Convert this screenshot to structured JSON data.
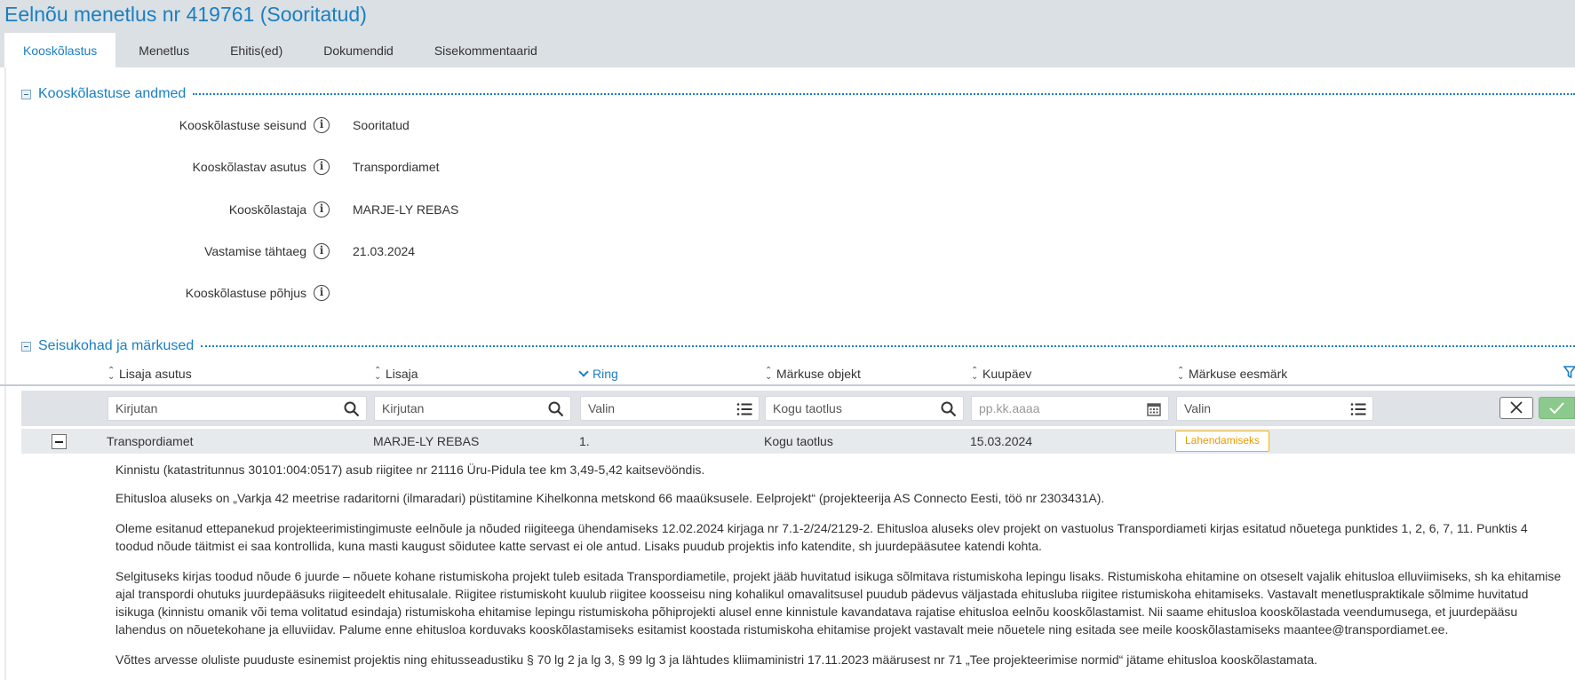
{
  "page": {
    "title": "Eelnõu menetlus nr 419761 (Sooritatud)"
  },
  "tabs": [
    {
      "label": "Kooskõlastus",
      "active": true
    },
    {
      "label": "Menetlus",
      "active": false
    },
    {
      "label": "Ehitis(ed)",
      "active": false
    },
    {
      "label": "Dokumendid",
      "active": false
    },
    {
      "label": "Sisekommentaarid",
      "active": false
    }
  ],
  "section_details": {
    "title": "Kooskõlastuse andmed",
    "fields": [
      {
        "label": "Kooskõlastuse seisund",
        "value": "Sooritatud"
      },
      {
        "label": "Kooskõlastav asutus",
        "value": "Transpordiamet"
      },
      {
        "label": "Kooskõlastaja",
        "value": "MARJE-LY REBAS"
      },
      {
        "label": "Vastamise tähtaeg",
        "value": "21.03.2024"
      },
      {
        "label": "Kooskõlastuse põhjus",
        "value": ""
      }
    ]
  },
  "section_remarks": {
    "title": "Seisukohad ja märkused",
    "columns": [
      "Lisaja asutus",
      "Lisaja",
      "Ring",
      "Märkuse objekt",
      "Kuupäev",
      "Märkuse eesmärk"
    ],
    "sorted_column": "Ring",
    "filters": {
      "asutus_placeholder": "Kirjutan",
      "lisaja_placeholder": "Kirjutan",
      "ring_placeholder": "Valin",
      "objekt_value": "Kogu taotlus",
      "kuupaev_placeholder": "pp.kk.aaaa",
      "eesmark_placeholder": "Valin"
    },
    "rows": [
      {
        "asutus": "Transpordiamet",
        "lisaja": "MARJE-LY REBAS",
        "ring": "1.",
        "objekt": "Kogu taotlus",
        "kuupaev": "15.03.2024",
        "eesmark": "Lahendamiseks",
        "comment": [
          "Kinnistu (katastritunnus 30101:004:0517) asub riigitee nr 21116 Üru-Pidula tee km 3,49-5,42 kaitsevööndis.",
          "Ehitusloa aluseks on „Varkja 42 meetrise radaritorni (ilmaradari) püstitamine Kihelkonna metskond 66 maaüksusele. Eelprojekt“ (projekteerija AS Connecto Eesti, töö nr 2303431A).",
          "Oleme esitanud ettepanekud projekteerimistingimuste eelnõule ja nõuded riigiteega ühendamiseks 12.02.2024 kirjaga nr 7.1-2/24/2129-2. Ehitusloa aluseks olev projekt on vastuolus Transpordiameti kirjas esitatud nõuetega punktides 1, 2, 6, 7, 11. Punktis 4 toodud nõude täitmist ei saa kontrollida, kuna masti kaugust sõidutee katte servast ei ole antud. Lisaks puudub projektis info katendite, sh juurdepääsutee katendi kohta.",
          "Selgituseks kirjas toodud nõude 6 juurde – nõuete kohane ristumiskoha projekt tuleb esitada Transpordiametile, projekt jääb huvitatud isikuga sõlmitava ristumiskoha lepingu lisaks. Ristumiskoha ehitamine on otseselt vajalik ehitusloa elluviimiseks, sh ka ehitamise ajal transpordi ohutuks juurdepääsuks riigiteedelt ehitusalale. Riigitee ristumiskoht kuulub riigitee koosseisu ning kohalikul omavalitsusel puudub pädevus väljastada ehitusluba riigitee ristumiskoha ehitamiseks. Vastavalt menetluspraktikale sõlmime huvitatud isikuga (kinnistu omanik või tema volitatud esindaja) ristumiskoha ehitamise lepingu ristumiskoha põhiprojekti alusel enne kinnistule kavandatava rajatise ehitusloa eelnõu kooskõlastamist. Nii saame ehitusloa kooskõlastada veendumusega, et juurdepääsu lahendus on nõuetekohane ja elluviidav. Palume enne ehitusloa korduvaks kooskõlastamiseks esitamist koostada ristumiskoha ehitamise projekt vastavalt meie nõuetele ning esitada see meile kooskõlastamiseks maantee@transpordiamet.ee.",
          "Võttes arvesse oluliste puuduste esinemist projektis ning ehitusseadustiku § 70 lg 2 ja lg 3, § 99 lg 3 ja lähtudes kliimaministri 17.11.2023 määrusest nr 71 „Tee projekteerimise normid“ jätame ehitusloa kooskõlastamata."
        ]
      }
    ]
  },
  "colors": {
    "accent": "#1a7fc1",
    "header_bg": "#dbe0e4",
    "badge_border": "#f5b400",
    "ok_button": "#8cc98c"
  },
  "icons": {
    "info": "info-icon",
    "search": "search-icon",
    "list": "list-icon",
    "calendar": "calendar-icon",
    "clear": "close-icon",
    "confirm": "checkmark-icon",
    "filter": "filter-icon"
  }
}
